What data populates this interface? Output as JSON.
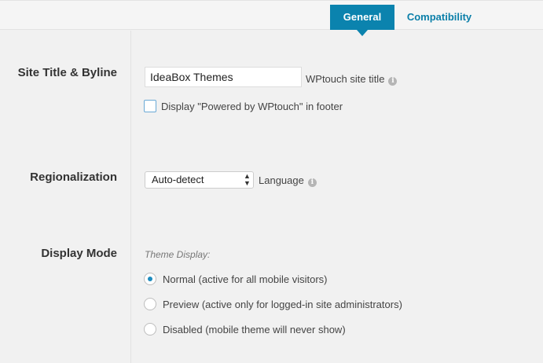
{
  "tabs": [
    {
      "label": "General",
      "active": true
    },
    {
      "label": "Compatibility",
      "active": false
    }
  ],
  "site_title": {
    "section_label": "Site Title & Byline",
    "input_value": "IdeaBox Themes",
    "input_label": "WPtouch site title",
    "powered_by_checkbox_label": "Display \"Powered by WPtouch\" in footer",
    "powered_by_checked": false
  },
  "regionalization": {
    "section_label": "Regionalization",
    "selected_value": "Auto-detect",
    "select_label": "Language"
  },
  "display_mode": {
    "section_label": "Display Mode",
    "group_label": "Theme Display:",
    "options": [
      {
        "label": "Normal (active for all mobile visitors)",
        "checked": true
      },
      {
        "label": "Preview (active only for logged-in site administrators)",
        "checked": false
      },
      {
        "label": "Disabled (mobile theme will never show)",
        "checked": false
      }
    ]
  },
  "icons": {
    "info": "info-icon",
    "select_arrows": "up-down-arrows-icon"
  },
  "colors": {
    "accent": "#0b83ae",
    "radio_selected": "#1e8cbe",
    "background": "#f1f1f1"
  }
}
